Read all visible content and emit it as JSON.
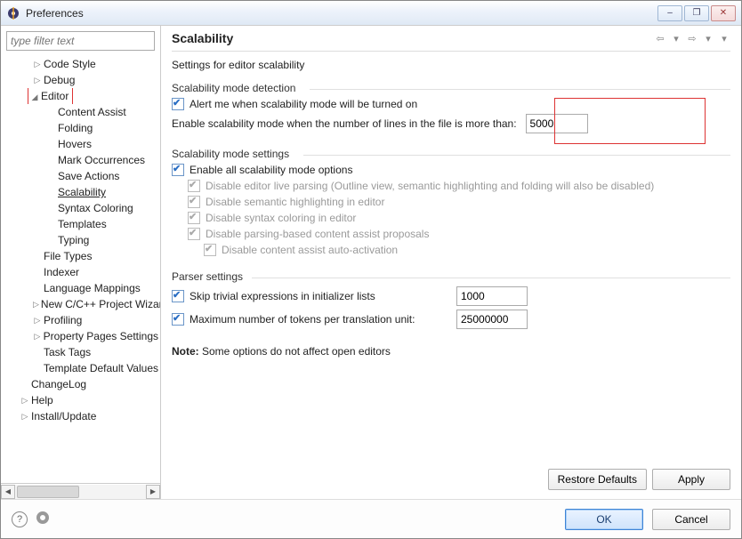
{
  "window": {
    "title": "Preferences",
    "min": "–",
    "restore": "❐",
    "close": "✕"
  },
  "filter": {
    "placeholder": "type filter text"
  },
  "tree": {
    "items": [
      {
        "level": 2,
        "expand": "▷",
        "label": "Code Style"
      },
      {
        "level": 2,
        "expand": "▷",
        "label": "Debug"
      },
      {
        "level": 2,
        "expand": "◢",
        "label": "Editor",
        "boxed": true
      },
      {
        "level": 3,
        "expand": "",
        "label": "Content Assist"
      },
      {
        "level": 3,
        "expand": "",
        "label": "Folding"
      },
      {
        "level": 3,
        "expand": "",
        "label": "Hovers"
      },
      {
        "level": 3,
        "expand": "",
        "label": "Mark Occurrences"
      },
      {
        "level": 3,
        "expand": "",
        "label": "Save Actions"
      },
      {
        "level": 3,
        "expand": "",
        "label": "Scalability",
        "underline": true
      },
      {
        "level": 3,
        "expand": "",
        "label": "Syntax Coloring"
      },
      {
        "level": 3,
        "expand": "",
        "label": "Templates"
      },
      {
        "level": 3,
        "expand": "",
        "label": "Typing"
      },
      {
        "level": 2,
        "expand": "",
        "label": "File Types"
      },
      {
        "level": 2,
        "expand": "",
        "label": "Indexer"
      },
      {
        "level": 2,
        "expand": "",
        "label": "Language Mappings"
      },
      {
        "level": 2,
        "expand": "▷",
        "label": "New C/C++ Project Wizard"
      },
      {
        "level": 2,
        "expand": "▷",
        "label": "Profiling"
      },
      {
        "level": 2,
        "expand": "▷",
        "label": "Property Pages Settings"
      },
      {
        "level": 2,
        "expand": "",
        "label": "Task Tags"
      },
      {
        "level": 2,
        "expand": "",
        "label": "Template Default Values"
      },
      {
        "level": 1,
        "expand": "",
        "label": "ChangeLog"
      },
      {
        "level": 1,
        "expand": "▷",
        "label": "Help"
      },
      {
        "level": 1,
        "expand": "▷",
        "label": "Install/Update"
      }
    ]
  },
  "main": {
    "heading": "Scalability",
    "subtitle": "Settings for editor scalability",
    "group1": {
      "title": "Scalability mode detection",
      "alert": "Alert me when scalability mode will be turned on",
      "enable_label": "Enable scalability mode when the number of lines in the file is more than:",
      "enable_value": "5000"
    },
    "group2": {
      "title": "Scalability mode settings",
      "enable_all": "Enable all scalability mode options",
      "opt1": "Disable editor live parsing (Outline view, semantic highlighting and folding will also be disabled)",
      "opt2": "Disable semantic highlighting in editor",
      "opt3": "Disable syntax coloring in editor",
      "opt4": "Disable parsing-based content assist proposals",
      "opt5": "Disable content assist auto-activation"
    },
    "group3": {
      "title": "Parser settings",
      "skip_label": "Skip trivial expressions in initializer lists",
      "skip_value": "1000",
      "max_label": "Maximum number of tokens per translation unit:",
      "max_value": "25000000"
    },
    "note_prefix": "Note:",
    "note_text": " Some options do not affect open editors"
  },
  "buttons": {
    "restore": "Restore Defaults",
    "apply": "Apply",
    "ok": "OK",
    "cancel": "Cancel"
  }
}
